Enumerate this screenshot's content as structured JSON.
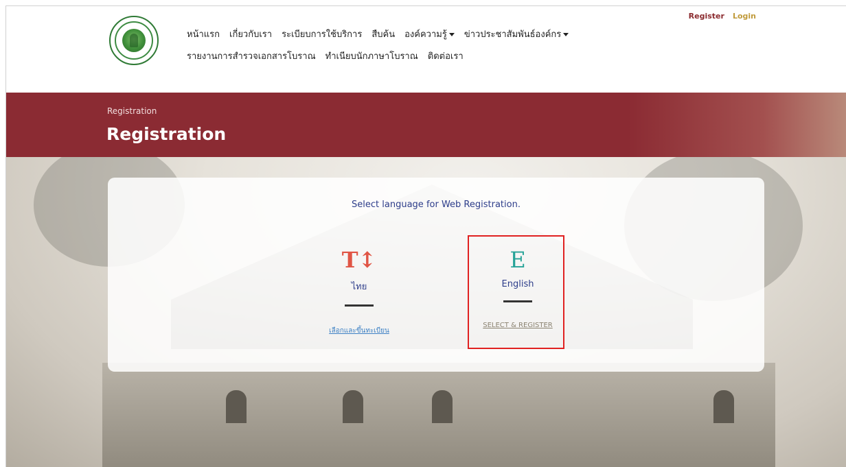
{
  "header": {
    "top_links": {
      "register": "Register",
      "login": "Login"
    },
    "nav_row1": [
      "หน้าแรก",
      "เกี่ยวกับเรา",
      "ระเบียบการใช้บริการ",
      "สืบค้น",
      "องค์ความรู้",
      "ข่าวประชาสัมพันธ์องค์กร"
    ],
    "nav_row2": [
      "รายงานการสำรวจเอกสารโบราณ",
      "ทำเนียบนักภาษาโบราณ",
      "ติดต่อเรา"
    ]
  },
  "banner": {
    "breadcrumb": "Registration",
    "title": "Registration"
  },
  "card": {
    "prompt": "Select language for Web Registration.",
    "thai": {
      "glyph": "T↕",
      "name": "ไทย",
      "link": "เลือกและขึ้นทะเบียน"
    },
    "english": {
      "glyph": "E",
      "name": "English",
      "link": "SELECT & REGISTER"
    }
  },
  "colors": {
    "banner": "#8b2b33",
    "accent_thai": "#e05545",
    "accent_english": "#26a398",
    "highlight": "#e02020"
  }
}
